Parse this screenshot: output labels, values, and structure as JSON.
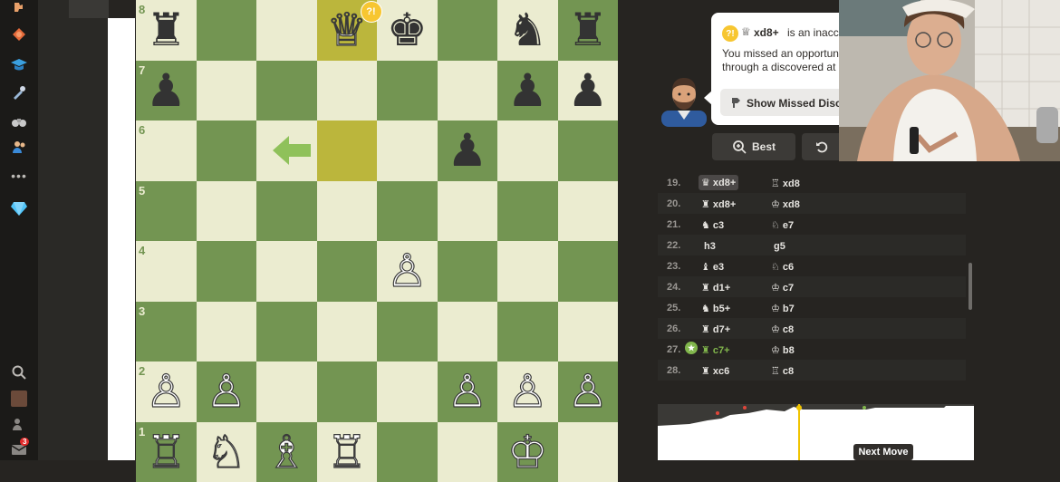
{
  "sidebar": {
    "icons": [
      "puzzle-icon",
      "target-icon",
      "learn-cap-icon",
      "tools-icon",
      "binoculars-icon",
      "friends-icon",
      "more-icon",
      "diamond-icon",
      "search-icon",
      "avatar-thumb-icon",
      "people-icon",
      "mail-icon"
    ],
    "mail_badge": "3"
  },
  "board": {
    "rank_labels": [
      "8",
      "7",
      "6",
      "5",
      "4",
      "3",
      "2",
      "1"
    ],
    "move_annotation": "?!"
  },
  "coach": {
    "annotation_badge": "?!",
    "headline_move": "xd8+",
    "headline_suffix": "is an inaccu",
    "body_line1": "You missed an opportun",
    "body_line2": "through a discovered at",
    "action_button": "Show Missed Disco"
  },
  "controls": {
    "best_label": "Best",
    "retry_icon": "undo-icon"
  },
  "moves": [
    {
      "num": "19.",
      "white_fig": "♛",
      "white": "xd8+",
      "black_fig": "♖",
      "black": "xd8",
      "highlight": true
    },
    {
      "num": "20.",
      "white_fig": "♜",
      "white": "xd8+",
      "black_fig": "♔",
      "black": "xd8"
    },
    {
      "num": "21.",
      "white_fig": "♞",
      "white": "c3",
      "black_fig": "♘",
      "black": "e7"
    },
    {
      "num": "22.",
      "white_fig": "",
      "white": "h3",
      "black_fig": "",
      "black": "g5"
    },
    {
      "num": "23.",
      "white_fig": "♝",
      "white": "e3",
      "black_fig": "♘",
      "black": "c6"
    },
    {
      "num": "24.",
      "white_fig": "♜",
      "white": "d1+",
      "black_fig": "♔",
      "black": "c7"
    },
    {
      "num": "25.",
      "white_fig": "♞",
      "white": "b5+",
      "black_fig": "♔",
      "black": "b7"
    },
    {
      "num": "26.",
      "white_fig": "♜",
      "white": "d7+",
      "black_fig": "♔",
      "black": "c8"
    },
    {
      "num": "27.",
      "white_fig": "♜",
      "white": "c7+",
      "black_fig": "♔",
      "black": "b8",
      "best": true
    },
    {
      "num": "28.",
      "white_fig": "♜",
      "white": "xc6",
      "black_fig": "♖",
      "black": "c8"
    }
  ],
  "graph": {
    "tooltip": "Next Move"
  },
  "colors": {
    "light_square": "#ebecd0",
    "dark_square": "#739552",
    "highlight_square": "#bbb63c",
    "arrow": "#8fc15a",
    "inaccuracy_badge": "#f7c631",
    "best_move": "#81b64c"
  }
}
